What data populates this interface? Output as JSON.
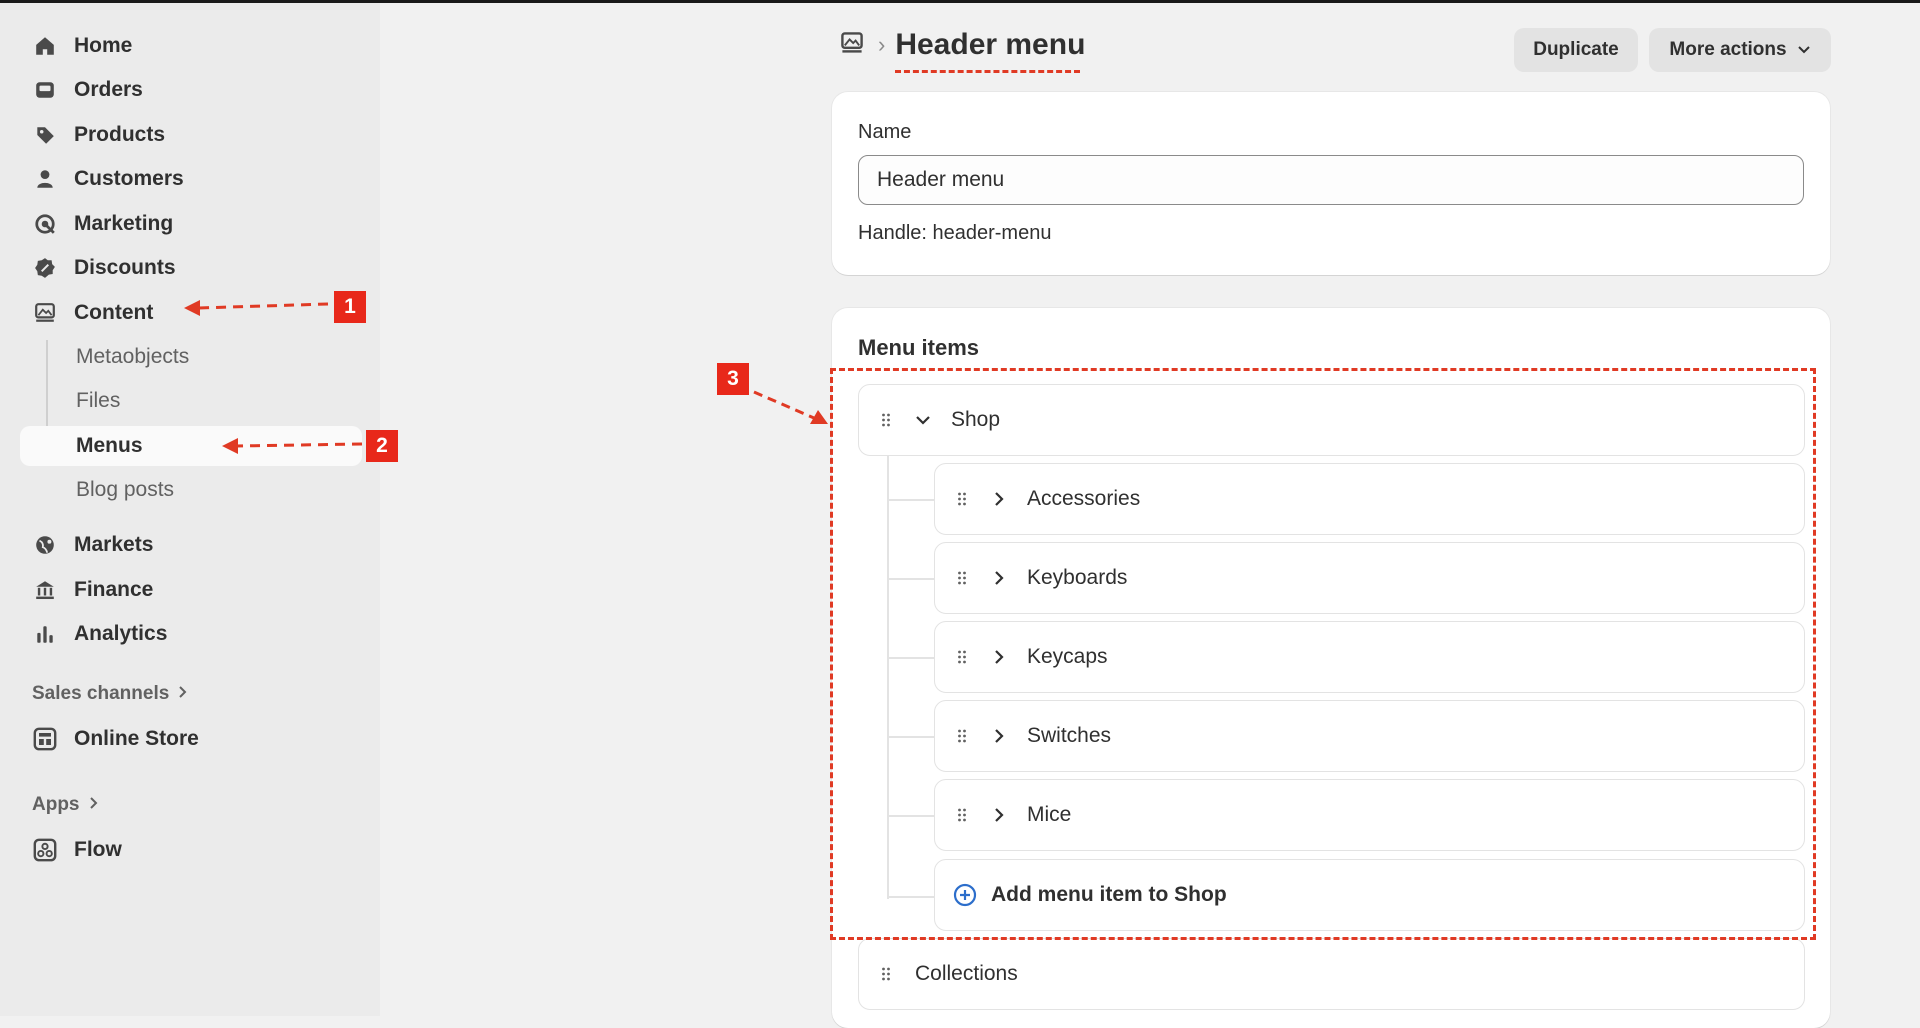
{
  "sidebar": {
    "items": [
      {
        "label": "Home",
        "icon": "home-icon"
      },
      {
        "label": "Orders",
        "icon": "inbox-icon"
      },
      {
        "label": "Products",
        "icon": "tag-icon"
      },
      {
        "label": "Customers",
        "icon": "person-icon"
      },
      {
        "label": "Marketing",
        "icon": "target-icon"
      },
      {
        "label": "Discounts",
        "icon": "discount-icon"
      },
      {
        "label": "Content",
        "icon": "content-icon"
      }
    ],
    "content_subitems": [
      {
        "label": "Metaobjects"
      },
      {
        "label": "Files"
      },
      {
        "label": "Menus",
        "active": true
      },
      {
        "label": "Blog posts"
      }
    ],
    "items_lower": [
      {
        "label": "Markets",
        "icon": "globe-icon"
      },
      {
        "label": "Finance",
        "icon": "bank-icon"
      },
      {
        "label": "Analytics",
        "icon": "bar-chart-icon"
      }
    ],
    "sales_channels_heading": "Sales channels",
    "online_store_label": "Online Store",
    "apps_heading": "Apps",
    "flow_label": "Flow"
  },
  "header": {
    "title": "Header menu",
    "duplicate_label": "Duplicate",
    "more_actions_label": "More actions"
  },
  "name_card": {
    "label": "Name",
    "value": "Header menu",
    "handle": "Handle: header-menu"
  },
  "menu_items": {
    "title": "Menu items",
    "parent": "Shop",
    "children": [
      "Accessories",
      "Keyboards",
      "Keycaps",
      "Switches",
      "Mice"
    ],
    "add_label": "Add menu item to Shop",
    "next": "Collections"
  },
  "annotations": [
    "1",
    "2",
    "3"
  ],
  "colors": {
    "annotation": "#e8281a",
    "add_icon": "#2c6ecb"
  }
}
